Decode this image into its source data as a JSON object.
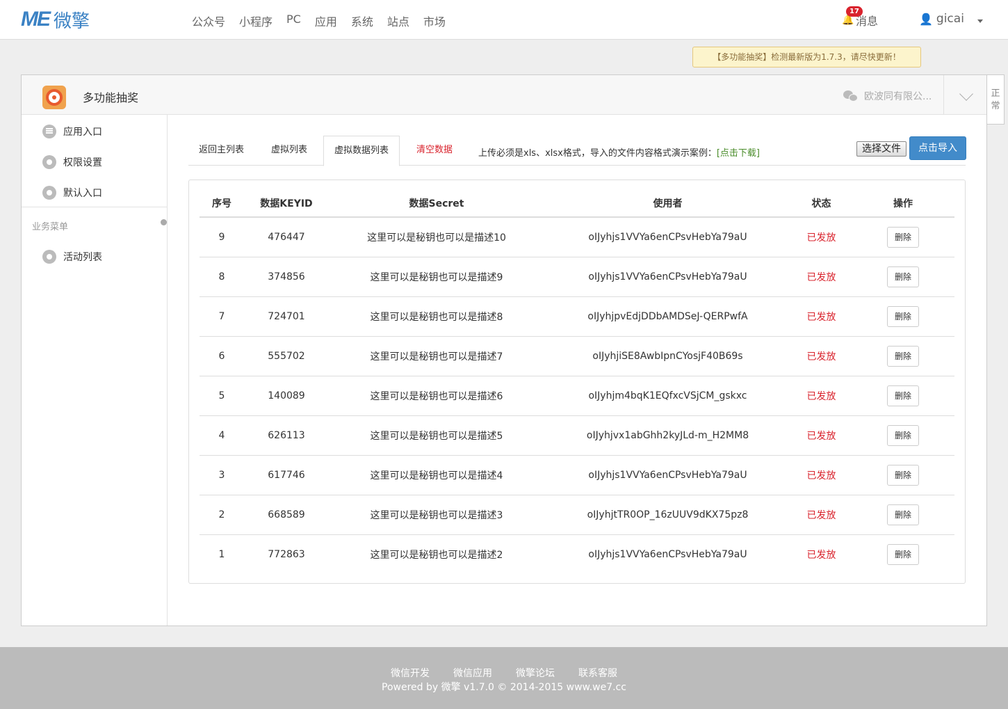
{
  "brand": {
    "logo_mark": "ME",
    "logo_text": "微擎"
  },
  "nav": [
    {
      "label": "公众号"
    },
    {
      "label": "小程序"
    },
    {
      "label": "PC"
    },
    {
      "label": "应用"
    },
    {
      "label": "系统"
    },
    {
      "label": "站点"
    },
    {
      "label": "市场"
    }
  ],
  "header": {
    "messages_label": "消息",
    "messages_count": "17",
    "username": "gicai"
  },
  "update_notice": "【多功能抽奖】检测最新版为1.7.3，请尽快更新！",
  "panel": {
    "app_title": "多功能抽奖",
    "account_name": "欧波同有限公...",
    "side_tab": "正常"
  },
  "sidebar": {
    "items": [
      {
        "label": "应用入口",
        "icon": "chat-icon"
      },
      {
        "label": "权限设置",
        "icon": "gear-icon"
      },
      {
        "label": "默认入口",
        "icon": "gear-icon"
      }
    ],
    "group_title": "业务菜单",
    "group_items": [
      {
        "label": "活动列表",
        "icon": "gear-icon"
      }
    ]
  },
  "tabs": [
    {
      "label": "返回主列表"
    },
    {
      "label": "虚拟列表"
    },
    {
      "label": "虚拟数据列表"
    },
    {
      "label": "清空数据"
    }
  ],
  "upload": {
    "note": "上传必须是xls、xlsx格式，导入的文件内容格式演示案例：",
    "download_link": "[点击下载]",
    "choose_file": "选择文件",
    "import_button": "点击导入"
  },
  "table": {
    "headers": [
      "序号",
      "数据KEYID",
      "数据Secret",
      "使用者",
      "状态",
      "操作"
    ],
    "rows": [
      {
        "id": "9",
        "keyid": "476447",
        "secret": "这里可以是秘钥也可以是描述10",
        "user": "oIJyhjs1VVYa6enCPsvHebYa79aU",
        "status": "已发放",
        "action": "删除"
      },
      {
        "id": "8",
        "keyid": "374856",
        "secret": "这里可以是秘钥也可以是描述9",
        "user": "oIJyhjs1VVYa6enCPsvHebYa79aU",
        "status": "已发放",
        "action": "删除"
      },
      {
        "id": "7",
        "keyid": "724701",
        "secret": "这里可以是秘钥也可以是描述8",
        "user": "oIJyhjpvEdjDDbAMDSeJ-QERPwfA",
        "status": "已发放",
        "action": "删除"
      },
      {
        "id": "6",
        "keyid": "555702",
        "secret": "这里可以是秘钥也可以是描述7",
        "user": "oIJyhjiSE8AwbIpnCYosjF40B69s",
        "status": "已发放",
        "action": "删除"
      },
      {
        "id": "5",
        "keyid": "140089",
        "secret": "这里可以是秘钥也可以是描述6",
        "user": "oIJyhjm4bqK1EQfxcVSjCM_gskxc",
        "status": "已发放",
        "action": "删除"
      },
      {
        "id": "4",
        "keyid": "626113",
        "secret": "这里可以是秘钥也可以是描述5",
        "user": "oIJyhjvx1abGhh2kyJLd-m_H2MM8",
        "status": "已发放",
        "action": "删除"
      },
      {
        "id": "3",
        "keyid": "617746",
        "secret": "这里可以是秘钥也可以是描述4",
        "user": "oIJyhjs1VVYa6enCPsvHebYa79aU",
        "status": "已发放",
        "action": "删除"
      },
      {
        "id": "2",
        "keyid": "668589",
        "secret": "这里可以是秘钥也可以是描述3",
        "user": "oIJyhjtTR0OP_16zUUV9dKX75pz8",
        "status": "已发放",
        "action": "删除"
      },
      {
        "id": "1",
        "keyid": "772863",
        "secret": "这里可以是秘钥也可以是描述2",
        "user": "oIJyhjs1VVYa6enCPsvHebYa79aU",
        "status": "已发放",
        "action": "删除"
      }
    ]
  },
  "footer": {
    "links": [
      {
        "label": "微信开发"
      },
      {
        "label": "微信应用"
      },
      {
        "label": "微擎论坛"
      },
      {
        "label": "联系客服"
      }
    ],
    "powered": "Powered by 微擎 v1.7.0 © 2014-2015 www.we7.cc"
  },
  "colors": {
    "primary": "#428bca",
    "danger": "#d9232d",
    "link_green": "#4a8c2a",
    "brand": "#3b82c4"
  }
}
